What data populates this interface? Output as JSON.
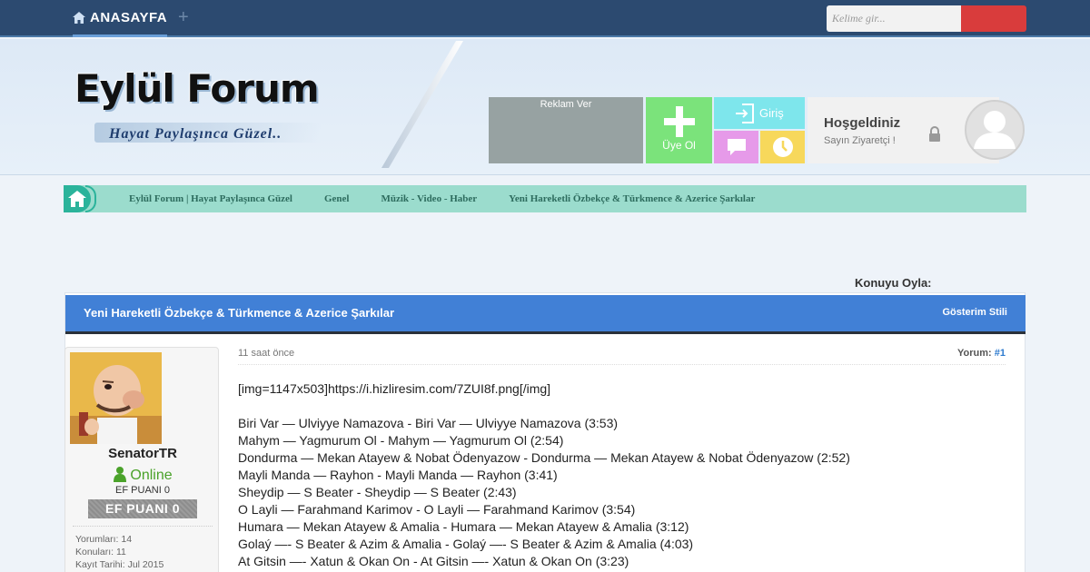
{
  "topbar": {
    "home_label": "ANASAYFA",
    "plus_label": "+",
    "search_placeholder": "Kelime gir..."
  },
  "header": {
    "logo_title": "Eylül Forum",
    "logo_subtitle": "Hayat Paylaşınca Güzel..",
    "ad_label": "Reklam Ver",
    "signup_label": "Üye Ol",
    "login_label": "Giriş",
    "welcome_title": "Hoşgeldiniz",
    "welcome_sub": "Sayın Ziyaretçi !"
  },
  "breadcrumbs": [
    "Eylül Forum | Hayat Paylaşınca Güzel",
    "Genel",
    "Müzik - Video - Haber",
    "Yeni Hareketli Özbekçe & Türkmence & Azerice Şarkılar"
  ],
  "rate_label": "Konuyu Oyla:",
  "thread": {
    "title": "Yeni Hareketli Özbekçe & Türkmence & Azerice Şarkılar",
    "display_style": "Gösterim Stili"
  },
  "post": {
    "time": "11 saat önce",
    "number_label": "Yorum:",
    "number": "#1",
    "lines": [
      "[img=1147x503]https://i.hizliresim.com/7ZUI8f.png[/img]",
      "",
      "Biri Var — Ulviyye Namazova - Biri Var — Ulviyye Namazova (3:53)",
      "Mahym — Yagmurum Ol - Mahym — Yagmurum Ol (2:54)",
      "Dondurma — Mekan Atayew & Nobat Ödenyazow - Dondurma — Mekan Atayew & Nobat Ödenyazow (2:52)",
      "Mayli Manda — Rayhon - Mayli Manda — Rayhon (3:41)",
      "Sheydip — S Beater - Sheydip — S Beater (2:43)",
      "O Layli — Farahmand Karimov - O Layli — Farahmand Karimov (3:54)",
      "Humara — Mekan Atayew & Amalia - Humara — Mekan Atayew & Amalia (3:12)",
      "Golaý —- S Beater & Azim & Amalia - Golaý —- S Beater & Azim & Amalia (4:03)",
      "At Gitsin —- Xatun & Okan On - At Gitsin —- Xatun & Okan On (3:23)"
    ]
  },
  "user": {
    "name": "SenatorTR",
    "status": "Online",
    "ef_text": "EF PUANI 0",
    "ef_badge": "EF PUANI 0",
    "posts_label": "Yorumları: 14",
    "topics_label": "Konuları: 11",
    "joined_label": "Kayıt Tarihi: Jul 2015"
  },
  "colors": {
    "topbar": "#2c4a70",
    "search_button": "#d93c3c",
    "ad_tile": "#97a2a2",
    "signup_tile": "#7be37b",
    "login_tile": "#7ee6ec",
    "message_tile": "#e69ae9",
    "clock_tile": "#f7d85b",
    "breadcrumb_bar": "#9bdccd",
    "thread_header": "#4180d6",
    "online": "#4aa22a"
  },
  "icons": [
    "home-icon",
    "plus-icon",
    "login-icon",
    "message-icon",
    "clock-icon",
    "lock-icon",
    "user-silhouette-icon",
    "online-user-icon"
  ]
}
